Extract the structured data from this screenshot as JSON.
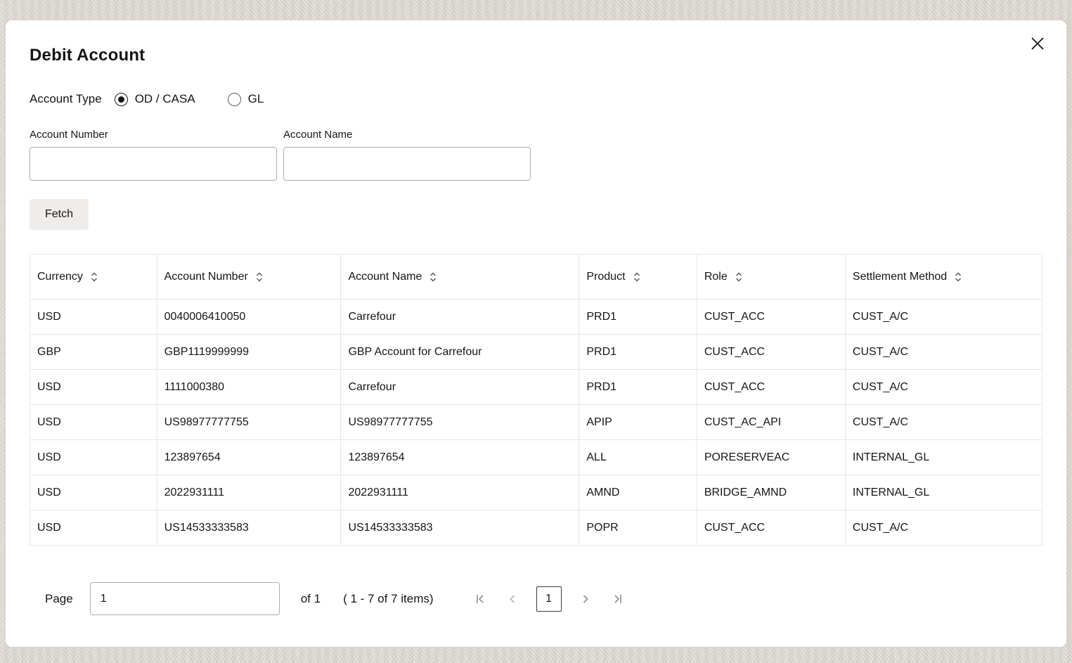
{
  "modal": {
    "title": "Debit Account"
  },
  "account_type": {
    "label": "Account Type",
    "options": [
      {
        "label": "OD / CASA",
        "selected": true
      },
      {
        "label": "GL",
        "selected": false
      }
    ]
  },
  "fields": {
    "account_number": {
      "label": "Account Number",
      "value": "",
      "placeholder": ""
    },
    "account_name": {
      "label": "Account Name",
      "value": "",
      "placeholder": ""
    }
  },
  "fetch_button": "Fetch",
  "table": {
    "columns": [
      "Currency",
      "Account Number",
      "Account Name",
      "Product",
      "Role",
      "Settlement Method"
    ],
    "rows": [
      [
        "USD",
        "0040006410050",
        "Carrefour",
        "PRD1",
        "CUST_ACC",
        "CUST_A/C"
      ],
      [
        "GBP",
        "GBP1119999999",
        "GBP Account for Carrefour",
        "PRD1",
        "CUST_ACC",
        "CUST_A/C"
      ],
      [
        "USD",
        "1111000380",
        "Carrefour",
        "PRD1",
        "CUST_ACC",
        "CUST_A/C"
      ],
      [
        "USD",
        "US98977777755",
        "US98977777755",
        "APIP",
        "CUST_AC_API",
        "CUST_A/C"
      ],
      [
        "USD",
        "123897654",
        "123897654",
        "ALL",
        "PORESERVEAC",
        "INTERNAL_GL"
      ],
      [
        "USD",
        "2022931111",
        "2022931111",
        "AMND",
        "BRIDGE_AMND",
        "INTERNAL_GL"
      ],
      [
        "USD",
        "US14533333583",
        "US14533333583",
        "POPR",
        "CUST_ACC",
        "CUST_A/C"
      ]
    ]
  },
  "pagination": {
    "page_label": "Page",
    "page_value": "1",
    "of_text": "of 1",
    "items_text": "( 1 - 7 of 7 items)",
    "current_page": "1"
  },
  "colors": {
    "text": "#161513",
    "table_border": "#e9e6e2",
    "icon_gray": "#76746f"
  }
}
